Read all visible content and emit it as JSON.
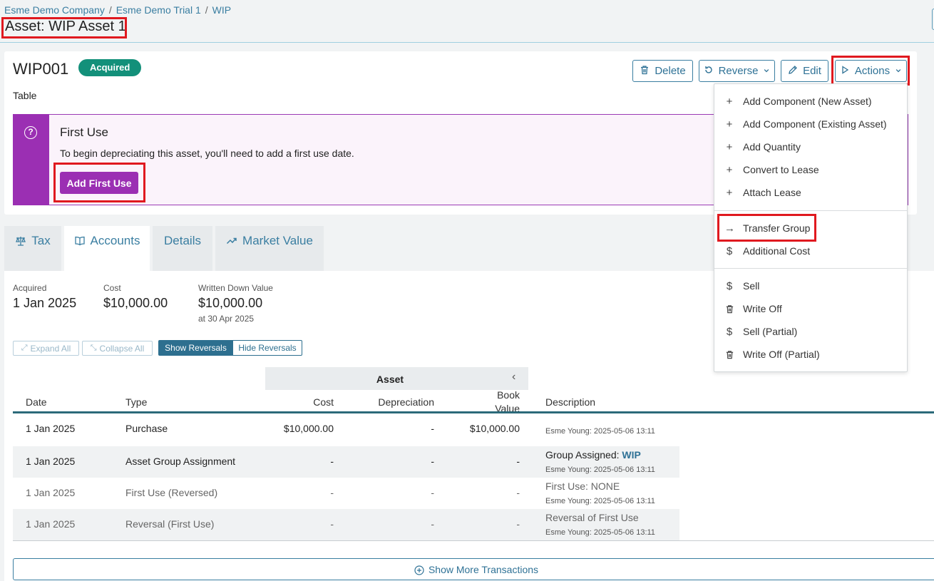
{
  "breadcrumb": [
    "Esme Demo Company",
    "Esme Demo Trial 1",
    "WIP"
  ],
  "page_title": "Asset: WIP Asset 1",
  "asset": {
    "code": "WIP001",
    "status": "Acquired",
    "type": "Table"
  },
  "toolbar": {
    "delete": "Delete",
    "reverse": "Reverse",
    "edit": "Edit",
    "actions": "Actions"
  },
  "first_use": {
    "title": "First Use",
    "text": "To begin depreciating this asset, you'll need to add a first use date.",
    "button": "Add First Use"
  },
  "tabs": [
    {
      "label": "Tax",
      "icon": "scale-icon"
    },
    {
      "label": "Accounts",
      "icon": "book-icon"
    },
    {
      "label": "Details",
      "icon": ""
    },
    {
      "label": "Market Value",
      "icon": "trending-up-icon"
    }
  ],
  "active_tab": "Accounts",
  "summary": {
    "acquired_label": "Acquired",
    "acquired_value": "1 Jan 2025",
    "cost_label": "Cost",
    "cost_value": "$10,000.00",
    "wdv_label": "Written Down Value",
    "wdv_value": "$10,000.00",
    "wdv_date": "at 30 Apr 2025"
  },
  "controls": {
    "expand_all": "Expand All",
    "collapse_all": "Collapse All",
    "show_reversals": "Show Reversals",
    "hide_reversals": "Hide Reversals"
  },
  "table": {
    "group_header": "Asset",
    "columns": {
      "date": "Date",
      "type": "Type",
      "cost": "Cost",
      "depreciation": "Depreciation",
      "book_value_1": "Book",
      "book_value_2": "Value",
      "description": "Description"
    },
    "rows": [
      {
        "date": "1 Jan 2025",
        "type": "Purchase",
        "cost": "$10,000.00",
        "depreciation": "-",
        "book_value": "$10,000.00",
        "description": "",
        "description_link": "",
        "meta": "Esme Young: 2025-05-06 13:11"
      },
      {
        "date": "1 Jan 2025",
        "type": "Asset Group Assignment",
        "cost": "-",
        "depreciation": "-",
        "book_value": "-",
        "description": "Group Assigned: ",
        "description_link": "WIP",
        "meta": "Esme Young: 2025-05-06 13:11"
      },
      {
        "date": "1 Jan 2025",
        "type": "First Use (Reversed)",
        "cost": "-",
        "depreciation": "-",
        "book_value": "-",
        "description": "First Use: NONE",
        "description_link": "",
        "meta": "Esme Young: 2025-05-06 13:11"
      },
      {
        "date": "1 Jan 2025",
        "type": "Reversal (First Use)",
        "cost": "-",
        "depreciation": "-",
        "book_value": "-",
        "description": "Reversal of First Use",
        "description_link": "",
        "meta": "Esme Young: 2025-05-06 13:11"
      }
    ],
    "show_more": "Show More Transactions"
  },
  "actions_menu": {
    "items": [
      {
        "label": "Add Component (New Asset)",
        "icon": "plus-icon"
      },
      {
        "label": "Add Component (Existing Asset)",
        "icon": "plus-icon"
      },
      {
        "label": "Add Quantity",
        "icon": "plus-icon"
      },
      {
        "label": "Convert to Lease",
        "icon": "plus-icon"
      },
      {
        "label": "Attach Lease",
        "icon": "plus-icon"
      },
      {
        "label": "Transfer Group",
        "icon": "arrow-right-icon"
      },
      {
        "label": "Additional Cost",
        "icon": "dollar-icon"
      },
      {
        "label": "Sell",
        "icon": "dollar-icon"
      },
      {
        "label": "Write Off",
        "icon": "trash-icon"
      },
      {
        "label": "Sell (Partial)",
        "icon": "dollar-icon"
      },
      {
        "label": "Write Off (Partial)",
        "icon": "trash-icon"
      }
    ]
  },
  "colors": {
    "accent": "#3a7ea1",
    "status_badge": "#13907a",
    "first_use": "#9b2fb3",
    "highlight": "#e0191f"
  }
}
